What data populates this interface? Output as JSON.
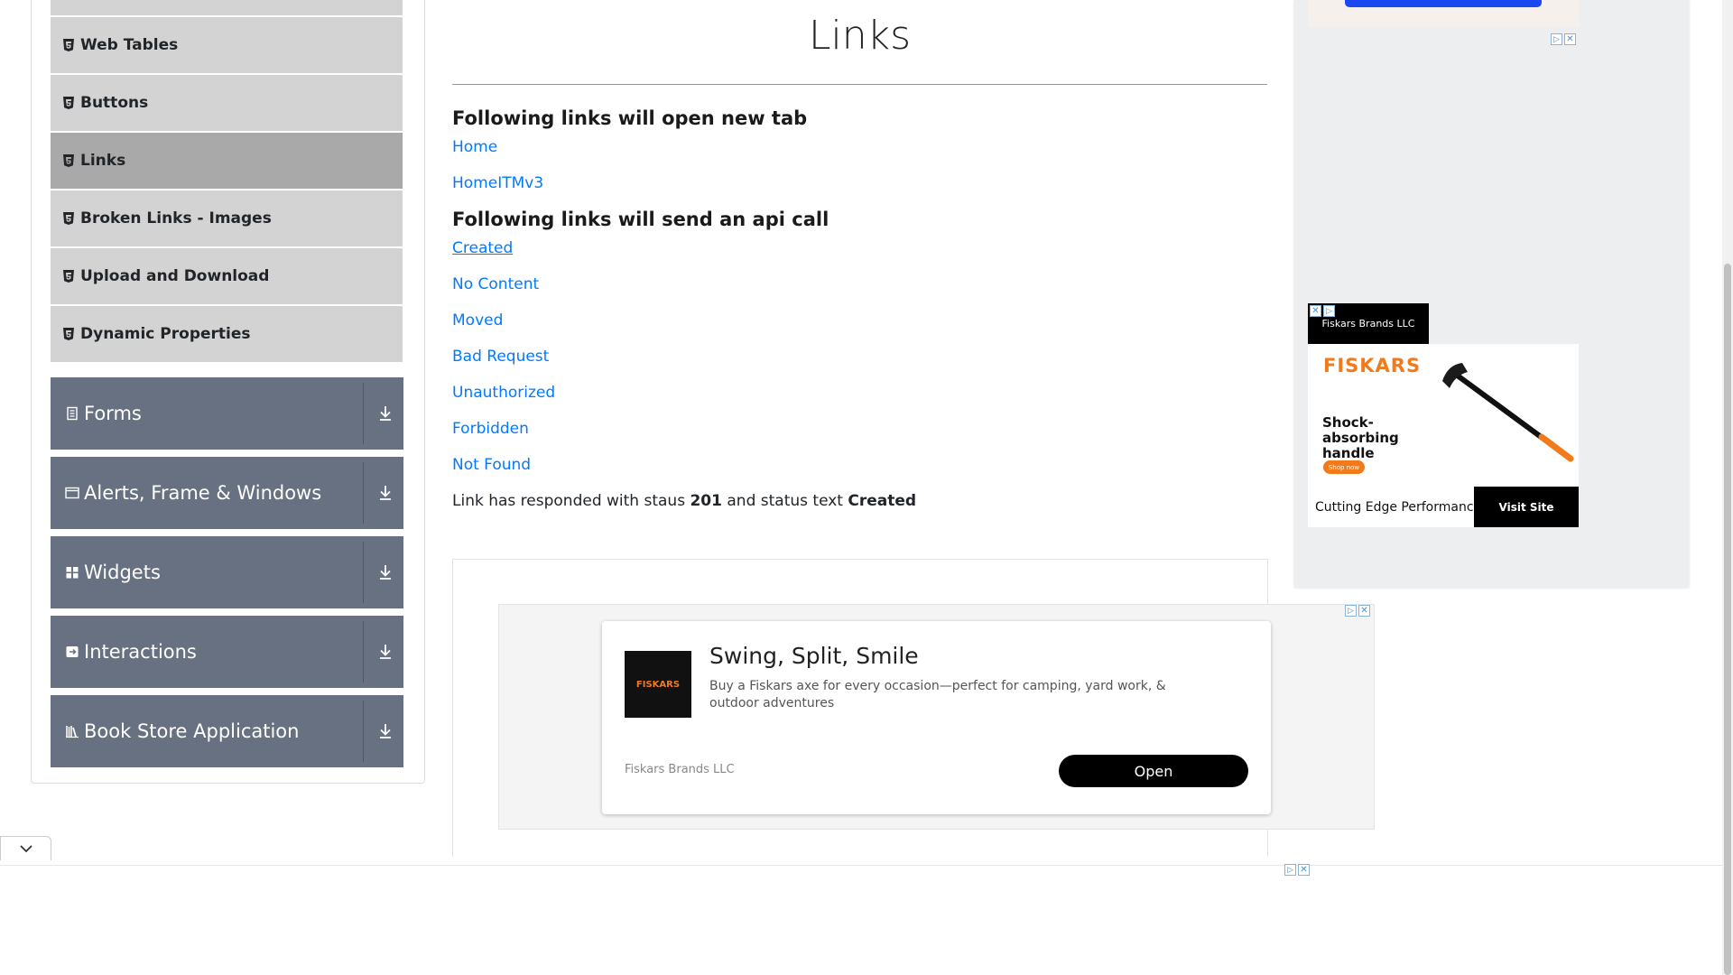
{
  "sidebar": {
    "elements_items": [
      {
        "label": ""
      },
      {
        "label": "Web Tables"
      },
      {
        "label": "Buttons"
      },
      {
        "label": "Links"
      },
      {
        "label": "Broken Links - Images"
      },
      {
        "label": "Upload and Download"
      },
      {
        "label": "Dynamic Properties"
      }
    ],
    "groups": [
      {
        "label": "Forms",
        "icon": "form-icon"
      },
      {
        "label": "Alerts, Frame & Windows",
        "icon": "window-icon"
      },
      {
        "label": "Widgets",
        "icon": "widgets-icon"
      },
      {
        "label": "Interactions",
        "icon": "interactions-icon"
      },
      {
        "label": "Book Store Application",
        "icon": "books-icon"
      }
    ]
  },
  "main": {
    "title": "Links",
    "new_tab_header": "Following links will open new tab",
    "new_tab_links": [
      "Home",
      "HomeITMv3"
    ],
    "api_header": "Following links will send an api call",
    "api_links": [
      "Created",
      "No Content",
      "Moved",
      "Bad Request",
      "Unauthorized",
      "Forbidden",
      "Not Found"
    ],
    "response": {
      "prefix": "Link has responded with staus ",
      "status_code": "201",
      "middle": " and status text ",
      "status_text": "Created"
    }
  },
  "content_ad": {
    "logo_text": "FISKARS",
    "headline": "Swing, Split, Smile",
    "body": "Buy a Fiskars axe for every occasion—perfect for camping, yard work, & outdoor adventures",
    "advertiser": "Fiskars Brands LLC",
    "cta": "Open"
  },
  "side_ad": {
    "advertiser": "Fiskars Brands LLC",
    "logo": "FISKARS",
    "tagline": "Shock-absorbing handle",
    "shop_label": "Shop now",
    "footer_text": "Cutting Edge Performance",
    "cta": "Visit Site"
  },
  "ad_controls": {
    "choices_glyph": "▷",
    "close_glyph": "✕"
  },
  "colors": {
    "link": "#007bff",
    "group_bg": "#687181",
    "sub_item_bg": "#d3d3d3",
    "active_item_bg": "#a9a9a9",
    "fiskars_orange": "#f27a1a"
  }
}
